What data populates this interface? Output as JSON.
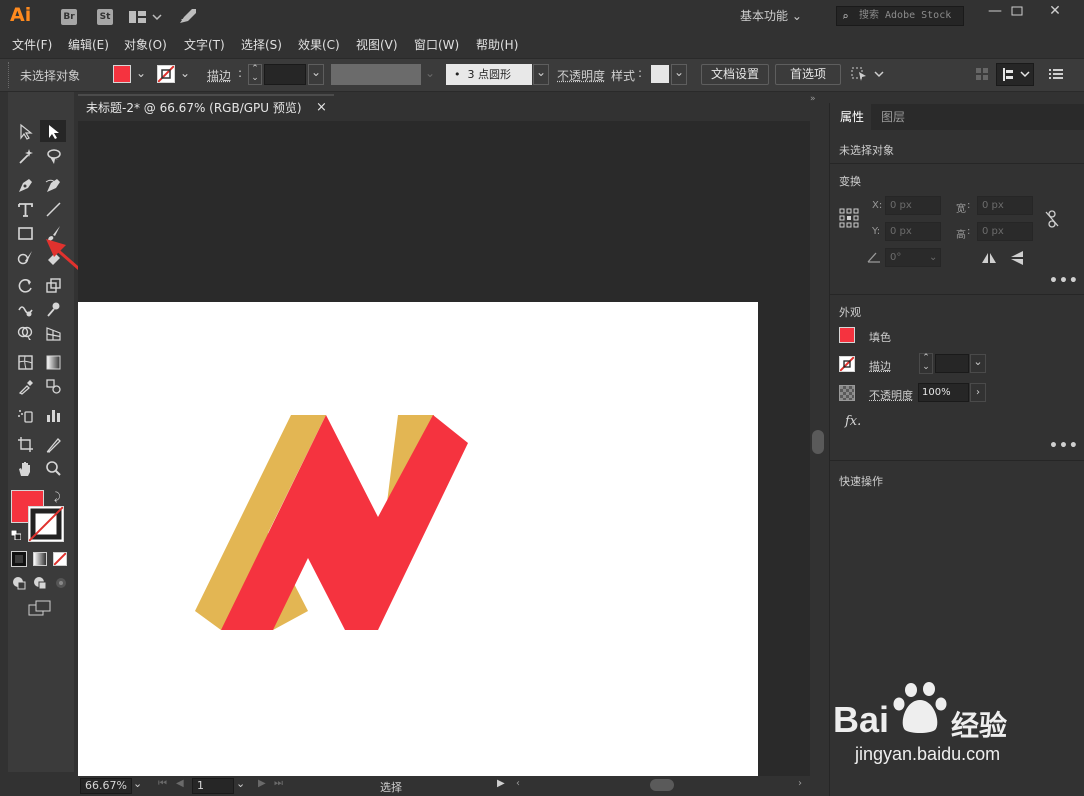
{
  "titlebar": {
    "logo": "Ai",
    "bridge": "Br",
    "stock": "St",
    "workspace": "基本功能",
    "search_placeholder": "搜索 Adobe Stock"
  },
  "menu": [
    "文件(F)",
    "编辑(E)",
    "对象(O)",
    "文字(T)",
    "选择(S)",
    "效果(C)",
    "视图(V)",
    "窗口(W)",
    "帮助(H)"
  ],
  "control": {
    "selection": "未选择对象",
    "stroke_label": "描边",
    "brush": "3 点圆形",
    "opacity_label": "不透明度",
    "style_label": "样式",
    "doc_setup": "文档设置",
    "prefs": "首选项"
  },
  "document": {
    "tab_title": "未标题-2* @ 66.67% (RGB/GPU 预览)",
    "close": "×"
  },
  "status": {
    "zoom": "66.67%",
    "page": "1",
    "mode": "选择"
  },
  "panel": {
    "tab_properties": "属性",
    "tab_layers": "图层",
    "no_selection": "未选择对象",
    "transform": "变换",
    "x_label": "X:",
    "y_label": "Y:",
    "w_label": "宽",
    "h_label": "高",
    "x_value": "0 px",
    "y_value": "0 px",
    "w_value": "0 px",
    "h_value": "0 px",
    "angle_value": "0°",
    "appearance": "外观",
    "fill": "填色",
    "stroke": "描边",
    "opacity": "不透明度",
    "opacity_value": "100%",
    "fx": "fx.",
    "quick_actions": "快速操作",
    "more": "•••"
  },
  "watermark": {
    "brand": "Bai",
    "brand2": "经验",
    "url": "jingyan.baidu.com"
  },
  "colors": {
    "fill": "#f5333f",
    "shadow": "#e3b653",
    "accent_arrow": "#e0322e"
  }
}
